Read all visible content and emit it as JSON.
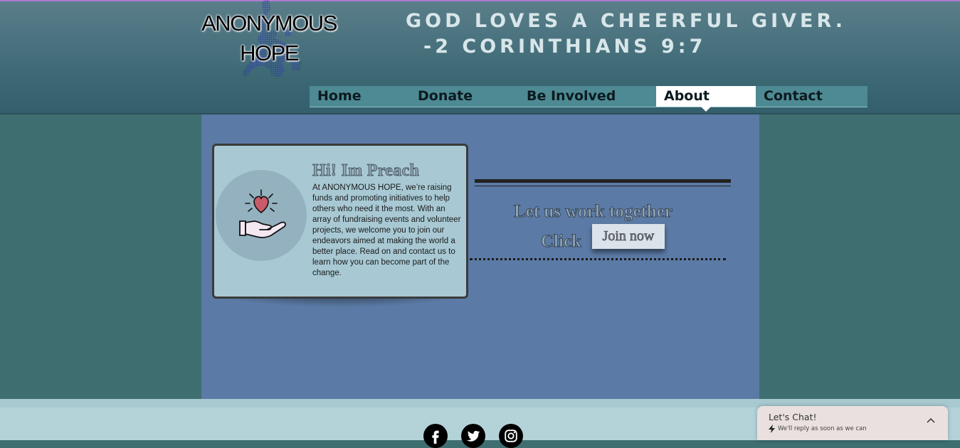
{
  "brand": {
    "name_line1": "ANONYMOUS",
    "name_line2": "HOPE"
  },
  "verse": {
    "line1": "GOD LOVES A CHEERFUL GIVER.",
    "line2": "-2 CORINTHIANS 9:7"
  },
  "nav": {
    "items": [
      {
        "label": "Home",
        "active": false
      },
      {
        "label": "Donate",
        "active": false
      },
      {
        "label": "Be Involved",
        "active": false
      },
      {
        "label": "About",
        "active": true
      },
      {
        "label": "Contact",
        "active": false
      }
    ]
  },
  "card": {
    "icon": "hand-holding-heart-icon",
    "title": "Hi! Im Preach",
    "body": "At ANONYMOUS HOPE, we’re raising funds and promoting initiatives to help others who need it the most. With an array of fundraising events and volunteer projects, we welcome you to join our endeavors aimed at making the world a better place. Read on and contact us to learn how you can become part of the change."
  },
  "cta": {
    "heading": "Let us work together",
    "click_label": "Click",
    "button_label": "Join now"
  },
  "social": [
    {
      "name": "facebook",
      "icon": "facebook-icon"
    },
    {
      "name": "twitter",
      "icon": "twitter-icon"
    },
    {
      "name": "instagram",
      "icon": "instagram-icon"
    }
  ],
  "chat": {
    "title": "Let's Chat!",
    "subtitle": "We'll reply as soon as we can"
  },
  "colors": {
    "page_bg": "#3e6e70",
    "content_bg": "#5b7aa5",
    "nav_bg": "#4d8a93",
    "card_bg": "#a8c9d4",
    "footer_bg": "#b3d3d9"
  }
}
